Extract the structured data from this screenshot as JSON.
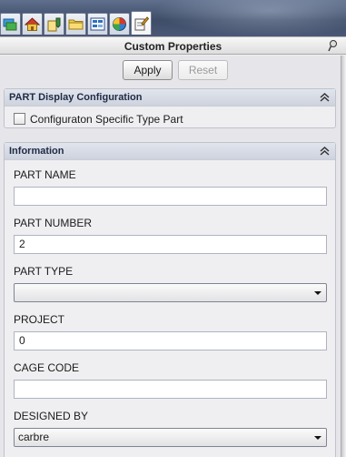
{
  "toolbar": {
    "tabs": [
      {
        "icon": "feature-manager-icon"
      },
      {
        "icon": "home-icon"
      },
      {
        "icon": "property-manager-icon"
      },
      {
        "icon": "folder-icon"
      },
      {
        "icon": "configuration-manager-icon"
      },
      {
        "icon": "appearance-icon"
      },
      {
        "icon": "custom-properties-icon"
      }
    ]
  },
  "panel": {
    "title": "Custom Properties",
    "apply_label": "Apply",
    "reset_label": "Reset"
  },
  "display_config": {
    "header": "PART Display Configuration",
    "checkbox_label": "Configuraton Specific Type Part",
    "checked": false
  },
  "information": {
    "header": "Information",
    "fields": {
      "part_name": {
        "label": "PART  NAME",
        "value": ""
      },
      "part_number": {
        "label": "PART NUMBER",
        "value": "2"
      },
      "part_type": {
        "label": "PART TYPE",
        "value": ""
      },
      "project": {
        "label": "PROJECT",
        "value": "0"
      },
      "cage_code": {
        "label": "CAGE CODE",
        "value": ""
      },
      "designed_by": {
        "label": "DESIGNED BY",
        "value": "carbre"
      }
    }
  }
}
